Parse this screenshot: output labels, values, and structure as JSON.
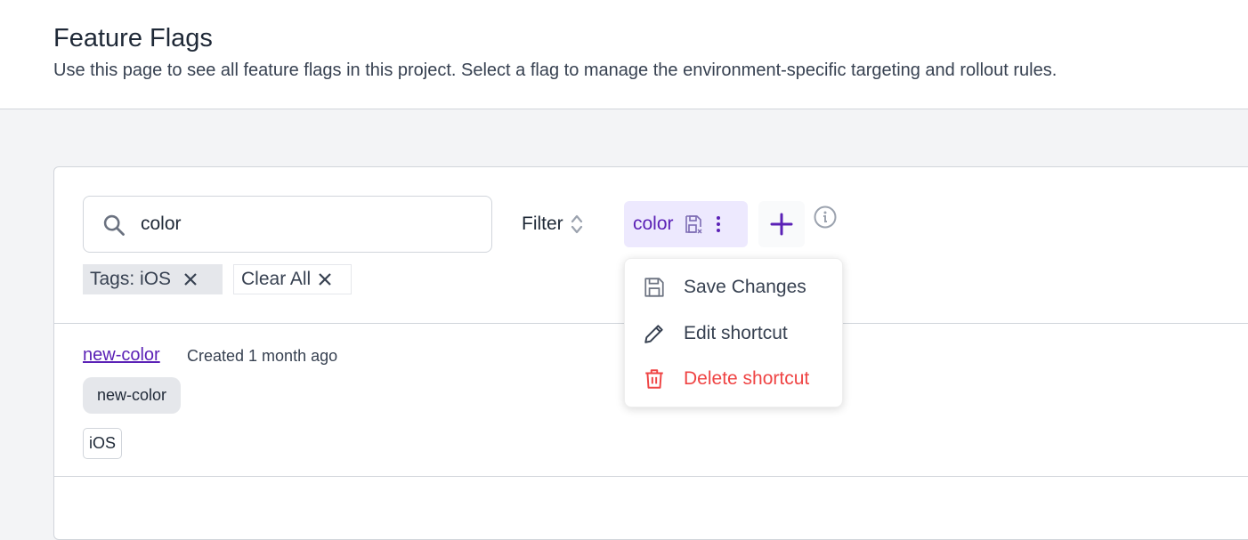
{
  "header": {
    "title": "Feature Flags",
    "subtitle": "Use this page to see all feature flags in this project. Select a flag to manage the environment-specific targeting and rollout rules."
  },
  "toolbar": {
    "search_value": "color",
    "filter_label": "Filter",
    "shortcut_label": "color"
  },
  "active_filters": [
    {
      "label": "Tags: iOS"
    },
    {
      "label": "Clear All"
    }
  ],
  "menu": {
    "items": [
      {
        "label": "Save Changes",
        "icon": "save-icon"
      },
      {
        "label": "Edit shortcut",
        "icon": "pencil-icon"
      },
      {
        "label": "Delete shortcut",
        "icon": "trash-icon",
        "color": "#ef4444"
      }
    ]
  },
  "flags": [
    {
      "name": "new-color",
      "created": "Created 1 month ago",
      "key_tag": "new-color",
      "tags": [
        "iOS"
      ]
    }
  ],
  "colors": {
    "accent": "#5b21b6",
    "chip_bg": "#ede9fe",
    "danger": "#ef4444"
  }
}
